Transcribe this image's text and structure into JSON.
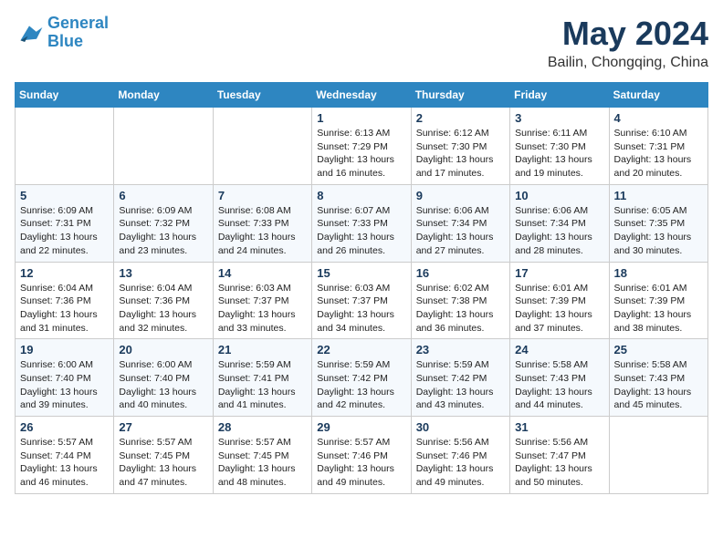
{
  "header": {
    "logo_line1": "General",
    "logo_line2": "Blue",
    "month": "May 2024",
    "location": "Bailin, Chongqing, China"
  },
  "days_of_week": [
    "Sunday",
    "Monday",
    "Tuesday",
    "Wednesday",
    "Thursday",
    "Friday",
    "Saturday"
  ],
  "weeks": [
    [
      {
        "day": "",
        "info": ""
      },
      {
        "day": "",
        "info": ""
      },
      {
        "day": "",
        "info": ""
      },
      {
        "day": "1",
        "info": "Sunrise: 6:13 AM\nSunset: 7:29 PM\nDaylight: 13 hours\nand 16 minutes."
      },
      {
        "day": "2",
        "info": "Sunrise: 6:12 AM\nSunset: 7:30 PM\nDaylight: 13 hours\nand 17 minutes."
      },
      {
        "day": "3",
        "info": "Sunrise: 6:11 AM\nSunset: 7:30 PM\nDaylight: 13 hours\nand 19 minutes."
      },
      {
        "day": "4",
        "info": "Sunrise: 6:10 AM\nSunset: 7:31 PM\nDaylight: 13 hours\nand 20 minutes."
      }
    ],
    [
      {
        "day": "5",
        "info": "Sunrise: 6:09 AM\nSunset: 7:31 PM\nDaylight: 13 hours\nand 22 minutes."
      },
      {
        "day": "6",
        "info": "Sunrise: 6:09 AM\nSunset: 7:32 PM\nDaylight: 13 hours\nand 23 minutes."
      },
      {
        "day": "7",
        "info": "Sunrise: 6:08 AM\nSunset: 7:33 PM\nDaylight: 13 hours\nand 24 minutes."
      },
      {
        "day": "8",
        "info": "Sunrise: 6:07 AM\nSunset: 7:33 PM\nDaylight: 13 hours\nand 26 minutes."
      },
      {
        "day": "9",
        "info": "Sunrise: 6:06 AM\nSunset: 7:34 PM\nDaylight: 13 hours\nand 27 minutes."
      },
      {
        "day": "10",
        "info": "Sunrise: 6:06 AM\nSunset: 7:34 PM\nDaylight: 13 hours\nand 28 minutes."
      },
      {
        "day": "11",
        "info": "Sunrise: 6:05 AM\nSunset: 7:35 PM\nDaylight: 13 hours\nand 30 minutes."
      }
    ],
    [
      {
        "day": "12",
        "info": "Sunrise: 6:04 AM\nSunset: 7:36 PM\nDaylight: 13 hours\nand 31 minutes."
      },
      {
        "day": "13",
        "info": "Sunrise: 6:04 AM\nSunset: 7:36 PM\nDaylight: 13 hours\nand 32 minutes."
      },
      {
        "day": "14",
        "info": "Sunrise: 6:03 AM\nSunset: 7:37 PM\nDaylight: 13 hours\nand 33 minutes."
      },
      {
        "day": "15",
        "info": "Sunrise: 6:03 AM\nSunset: 7:37 PM\nDaylight: 13 hours\nand 34 minutes."
      },
      {
        "day": "16",
        "info": "Sunrise: 6:02 AM\nSunset: 7:38 PM\nDaylight: 13 hours\nand 36 minutes."
      },
      {
        "day": "17",
        "info": "Sunrise: 6:01 AM\nSunset: 7:39 PM\nDaylight: 13 hours\nand 37 minutes."
      },
      {
        "day": "18",
        "info": "Sunrise: 6:01 AM\nSunset: 7:39 PM\nDaylight: 13 hours\nand 38 minutes."
      }
    ],
    [
      {
        "day": "19",
        "info": "Sunrise: 6:00 AM\nSunset: 7:40 PM\nDaylight: 13 hours\nand 39 minutes."
      },
      {
        "day": "20",
        "info": "Sunrise: 6:00 AM\nSunset: 7:40 PM\nDaylight: 13 hours\nand 40 minutes."
      },
      {
        "day": "21",
        "info": "Sunrise: 5:59 AM\nSunset: 7:41 PM\nDaylight: 13 hours\nand 41 minutes."
      },
      {
        "day": "22",
        "info": "Sunrise: 5:59 AM\nSunset: 7:42 PM\nDaylight: 13 hours\nand 42 minutes."
      },
      {
        "day": "23",
        "info": "Sunrise: 5:59 AM\nSunset: 7:42 PM\nDaylight: 13 hours\nand 43 minutes."
      },
      {
        "day": "24",
        "info": "Sunrise: 5:58 AM\nSunset: 7:43 PM\nDaylight: 13 hours\nand 44 minutes."
      },
      {
        "day": "25",
        "info": "Sunrise: 5:58 AM\nSunset: 7:43 PM\nDaylight: 13 hours\nand 45 minutes."
      }
    ],
    [
      {
        "day": "26",
        "info": "Sunrise: 5:57 AM\nSunset: 7:44 PM\nDaylight: 13 hours\nand 46 minutes."
      },
      {
        "day": "27",
        "info": "Sunrise: 5:57 AM\nSunset: 7:45 PM\nDaylight: 13 hours\nand 47 minutes."
      },
      {
        "day": "28",
        "info": "Sunrise: 5:57 AM\nSunset: 7:45 PM\nDaylight: 13 hours\nand 48 minutes."
      },
      {
        "day": "29",
        "info": "Sunrise: 5:57 AM\nSunset: 7:46 PM\nDaylight: 13 hours\nand 49 minutes."
      },
      {
        "day": "30",
        "info": "Sunrise: 5:56 AM\nSunset: 7:46 PM\nDaylight: 13 hours\nand 49 minutes."
      },
      {
        "day": "31",
        "info": "Sunrise: 5:56 AM\nSunset: 7:47 PM\nDaylight: 13 hours\nand 50 minutes."
      },
      {
        "day": "",
        "info": ""
      }
    ]
  ]
}
